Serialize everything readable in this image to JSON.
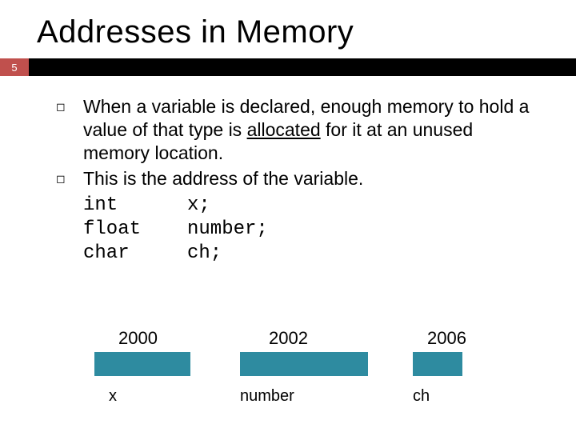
{
  "title": "Addresses in Memory",
  "page_number": "5",
  "bullets": [
    {
      "pre": "When a variable is declared, enough memory to hold a value of that type is ",
      "underlined": "allocated",
      "post": " for it at an unused memory location."
    },
    {
      "pre": "This is the address of the variable.",
      "underlined": "",
      "post": ""
    }
  ],
  "code": [
    {
      "type": "int",
      "rest": "x;"
    },
    {
      "type": "float",
      "rest": "number;"
    },
    {
      "type": "char",
      "rest": "ch;"
    }
  ],
  "memory": {
    "addresses": [
      "2000",
      "2002",
      "2006"
    ],
    "vars": [
      "x",
      "number",
      "ch"
    ]
  },
  "colors": {
    "accent": "#c0504d",
    "box": "#2e8ba0"
  }
}
